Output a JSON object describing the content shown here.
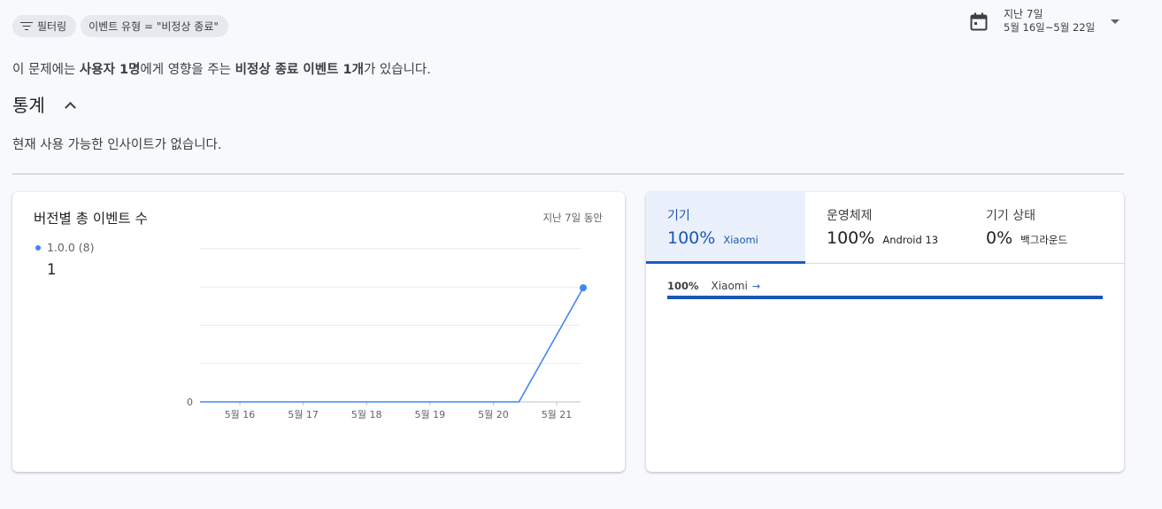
{
  "filters": {
    "filter_button": "필터링",
    "event_type_chip": "이벤트 유형 = \"비정상 종료\""
  },
  "date_range": {
    "label": "지난 7일",
    "range": "5월 16일~5월 22일"
  },
  "summary": {
    "part1": "이 문제에는 ",
    "bold1": "사용자 1명",
    "part2": "에게 영향을 주는 ",
    "bold2": "비정상 종료 이벤트 1개",
    "part3": "가 있습니다."
  },
  "stats": {
    "title": "통계",
    "no_insight": "현재 사용 가능한 인사이트가 없습니다."
  },
  "version_card": {
    "title": "버전별 총 이벤트 수",
    "period": "지난 7일 동안",
    "legend_label": "1.0.0 (8)",
    "legend_value": "1"
  },
  "chart_data": {
    "type": "line",
    "categories": [
      "5월 16",
      "5월 17",
      "5월 18",
      "5월 19",
      "5월 20",
      "5월 21"
    ],
    "series": [
      {
        "name": "1.0.0",
        "values": [
          0,
          0,
          0,
          0,
          0,
          1
        ]
      }
    ],
    "y_tick_labels": [
      "0"
    ],
    "ylim": [
      0,
      1.35
    ],
    "grid": true,
    "color": "#4285f4"
  },
  "device_card": {
    "tabs": [
      {
        "label": "기기",
        "percent": "100%",
        "name": "Xiaomi",
        "active": true
      },
      {
        "label": "운영체제",
        "percent": "100%",
        "name": "Android 13",
        "active": false
      },
      {
        "label": "기기 상태",
        "percent": "0%",
        "name": "백그라운드",
        "active": false
      }
    ],
    "breakdown": {
      "percent": "100%",
      "name": "Xiaomi",
      "arrow": "→",
      "fraction": 1.0
    },
    "accent_color": "#1a56b8"
  }
}
